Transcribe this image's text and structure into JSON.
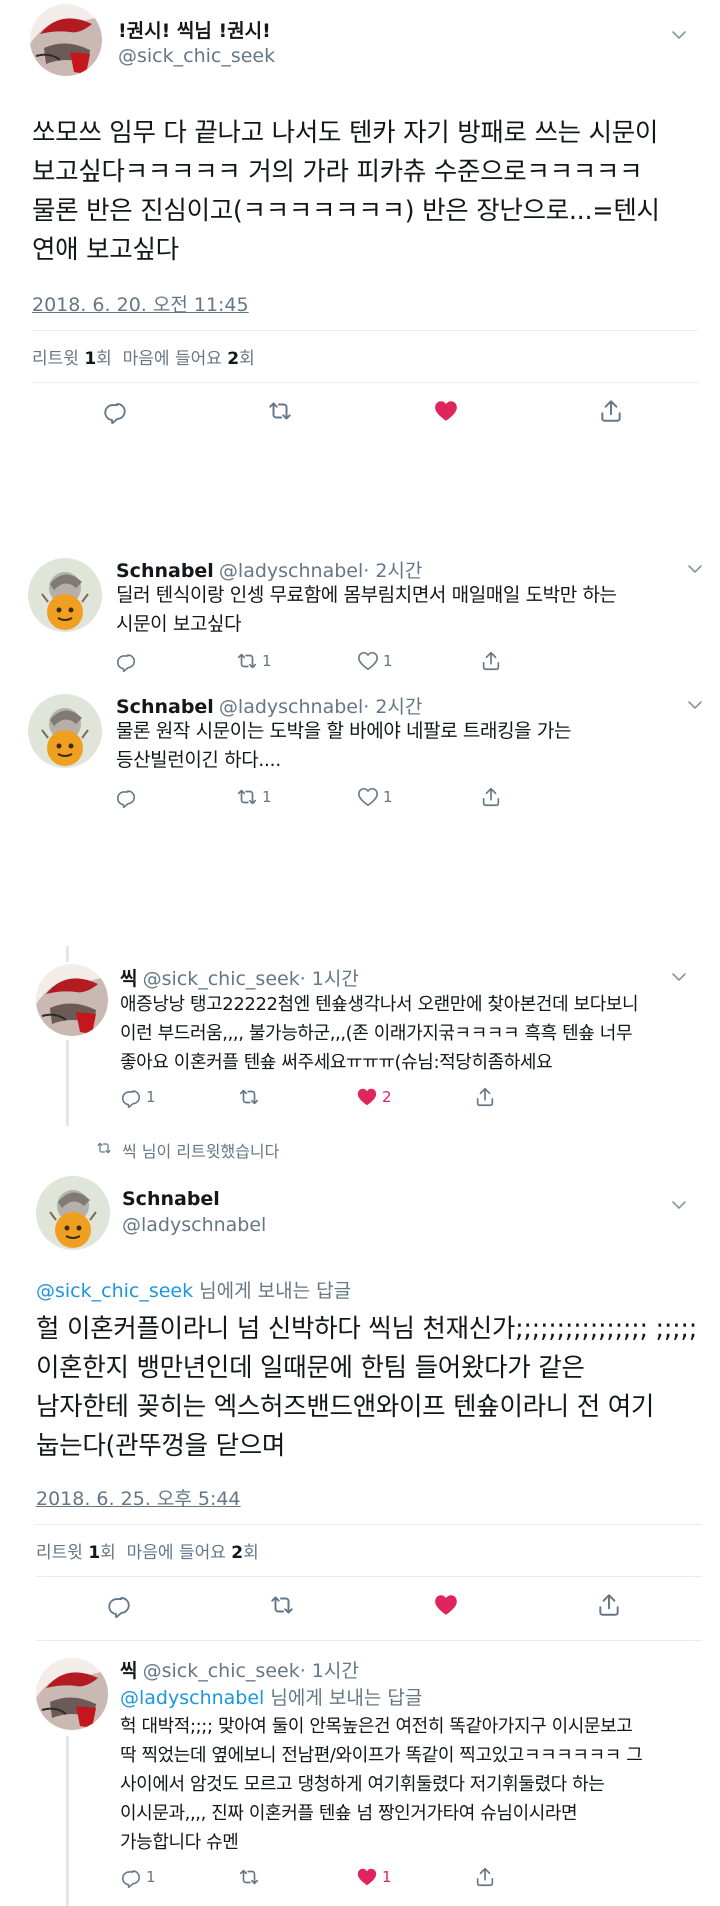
{
  "tweet1": {
    "display_name": "!권시! 씩님 !권시!",
    "handle": "@sick_chic_seek",
    "lines": [
      "쏘모쓰 임무 다 끝나고 나서도 텐카 자기 방패로 쓰는 시문이",
      "보고싶다ㅋㅋㅋㅋㅋ 거의 가라 피카츄 수준으로ㅋㅋㅋㅋㅋ",
      "물론 반은 진심이고(ㅋㅋㅋㅋㅋㅋㅋ) 반은 장난으로...=텐시",
      "연애 보고싶다"
    ],
    "timestamp": "2018. 6. 20. 오전 11:45",
    "retweets_label": "리트윗",
    "retweets_count": "1",
    "retweets_unit": "회",
    "likes_label": "마음에 들어요",
    "likes_count": "2",
    "likes_unit": "회"
  },
  "reply1": {
    "display_name": "Schnabel",
    "handle": "@ladyschnabel",
    "time": "· 2시간",
    "lines": [
      "딜러 텐식이랑 인셍 무료함에 몸부림치면서 매일매일 도박만 하는",
      "시문이 보고싶다"
    ],
    "retweet_count": "1",
    "like_count": "1"
  },
  "reply2": {
    "display_name": "Schnabel",
    "handle": "@ladyschnabel",
    "time": "· 2시간",
    "lines": [
      "물론 원작 시문이는 도박을 할 바에야 네팔로 트래킹을 가는",
      "등산빌런이긴 하다...."
    ],
    "retweet_count": "1",
    "like_count": "1"
  },
  "reply3": {
    "display_name": "씩",
    "handle": "@sick_chic_seek",
    "time": "· 1시간",
    "lines": [
      "애증낭낭 탱고22222첨엔 텐숖생각나서 오랜만에 찾아본건데 보다보니",
      "이런 부드러움,,,, 불가능하군,,,(존 이래가지굮ㅋㅋㅋㅋ 흑흑 텐숖 너무",
      "좋아요 이혼커플 텐숖 써주세요ㅠㅠㅠ(슈님:적당히좀하세요"
    ],
    "reply_count": "1",
    "like_count": "2"
  },
  "retweeted_note": "씩 님이 리트윗했습니다",
  "main": {
    "display_name": "Schnabel",
    "handle": "@ladyschnabel",
    "reply_to_handle": "@sick_chic_seek",
    "reply_to_suffix": "님에게 보내는 답글",
    "lines": [
      "헐 이혼커플이라니 넘 신박하다 씩님 천재신가;;;;;;;;;;;;;;;; ;;;;;",
      "이혼한지 뱅만년인데 일때문에 한팀 들어왔다가 같은",
      "남자한테 꽂히는 엑스허즈밴드앤와이프 텐숖이라니 전 여기",
      "눕는다(관뚜껑을 닫으며"
    ],
    "timestamp": "2018. 6. 25. 오후 5:44",
    "retweets_label": "리트윗",
    "retweets_count": "1",
    "retweets_unit": "회",
    "likes_label": "마음에 들어요",
    "likes_count": "2",
    "likes_unit": "회"
  },
  "reply4": {
    "display_name": "씩",
    "handle": "@sick_chic_seek",
    "time": "· 1시간",
    "reply_to_handle": "@ladyschnabel",
    "reply_to_suffix": "님에게 보내는 답글",
    "lines": [
      "헉 대박적;;;; 맞아여 둘이 안목높은건 여전히 똑같아가지구 이시문보고",
      "딱 찍었는데 옆에보니 전남편/와이프가 똑같이 찍고있고ㅋㅋㅋㅋㅋㅋ 그",
      "사이에서 암것도 모르고 댕청하게 여기휘둘렸다 저기휘둘렸다 하는",
      "이시문과,,,, 진짜 이혼커플 텐숖 넘 짱인거가타여 슈님이시라면",
      "가능합니다 슈멘"
    ],
    "reply_count": "1",
    "like_count": "1"
  },
  "colors": {
    "like_red": "#e0245e",
    "icon_gray": "#657786",
    "link_blue": "#1b95e0"
  }
}
